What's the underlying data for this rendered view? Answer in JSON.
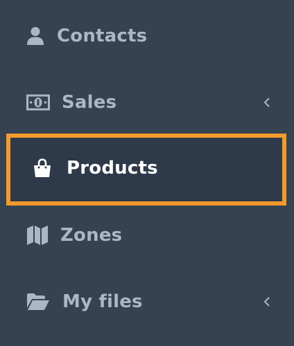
{
  "sidebar": {
    "items": [
      {
        "label": "Contacts",
        "icon": "user-icon",
        "has_submenu": false,
        "active": false
      },
      {
        "label": "Sales",
        "icon": "money-icon",
        "has_submenu": true,
        "active": false
      },
      {
        "label": "Products",
        "icon": "shopping-bag-icon",
        "has_submenu": false,
        "active": true
      },
      {
        "label": "Zones",
        "icon": "map-icon",
        "has_submenu": false,
        "active": false
      },
      {
        "label": "My files",
        "icon": "folder-open-icon",
        "has_submenu": true,
        "active": false
      }
    ]
  },
  "colors": {
    "background": "#354252",
    "text": "#a9b7c6",
    "active_text": "#ffffff",
    "active_background": "#2e3a49",
    "highlight_border": "#f39a2e"
  }
}
